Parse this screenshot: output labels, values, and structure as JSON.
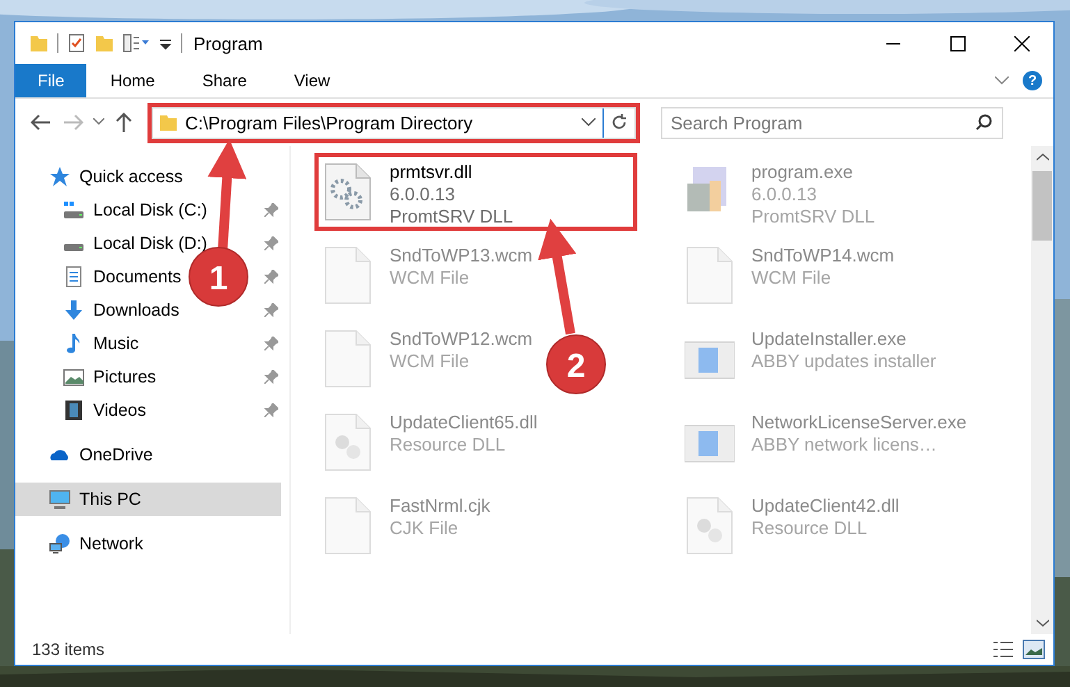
{
  "window": {
    "title": "Program"
  },
  "ribbon": {
    "tabs": [
      {
        "label": "File",
        "kind": "file"
      },
      {
        "label": "Home",
        "kind": "tab"
      },
      {
        "label": "Share",
        "kind": "tab"
      },
      {
        "label": "View",
        "kind": "tab"
      }
    ],
    "help": "?"
  },
  "address_bar": {
    "path": "C:\\Program Files\\Program Directory",
    "highlighted": true
  },
  "search": {
    "placeholder": "Search Program"
  },
  "navigation": [
    {
      "label": "Quick access",
      "kind": "star",
      "selected": false,
      "children": [
        {
          "label": "Local Disk (C:)",
          "kind": "system-drive",
          "pinned": true,
          "selected": false
        },
        {
          "label": "Local Disk (D:)",
          "kind": "drive",
          "pinned": true,
          "selected": false
        },
        {
          "label": "Documents",
          "kind": "documents",
          "pinned": true,
          "selected": false
        },
        {
          "label": "Downloads",
          "kind": "downloads",
          "pinned": true,
          "selected": false
        },
        {
          "label": "Music",
          "kind": "music",
          "pinned": true,
          "selected": false
        },
        {
          "label": "Pictures",
          "kind": "pictures",
          "pinned": true,
          "selected": false
        },
        {
          "label": "Videos",
          "kind": "videos",
          "pinned": true,
          "selected": false
        }
      ]
    },
    {
      "label": "OneDrive",
      "kind": "cloud",
      "selected": false
    },
    {
      "label": "This PC",
      "kind": "computer",
      "selected": true
    },
    {
      "label": "Network",
      "kind": "network",
      "selected": false
    }
  ],
  "files": [
    {
      "name": "prmtsvr.dll",
      "details": [
        "6.0.0.13",
        "PromtSRV DLL"
      ],
      "kind": "gear-doc",
      "highlighted": true,
      "faded": false
    },
    {
      "name": "program.exe",
      "details": [
        "6.0.0.13",
        "PromtSRV DLL"
      ],
      "kind": "installer",
      "highlighted": false,
      "faded": true
    },
    {
      "name": "SndToWP13.wcm",
      "details": [
        "WCM File"
      ],
      "kind": "blank",
      "highlighted": false,
      "faded": true
    },
    {
      "name": "SndToWP14.wcm",
      "details": [
        "WCM File"
      ],
      "kind": "blank",
      "highlighted": false,
      "faded": true
    },
    {
      "name": "SndToWP12.wcm",
      "details": [
        "WCM File"
      ],
      "kind": "blank",
      "highlighted": false,
      "faded": true
    },
    {
      "name": "UpdateInstaller.exe",
      "details": [
        "ABBY updates installer"
      ],
      "kind": "app",
      "highlighted": false,
      "faded": true
    },
    {
      "name": "UpdateClient65.dll",
      "details": [
        "Resource DLL"
      ],
      "kind": "dll",
      "highlighted": false,
      "faded": true
    },
    {
      "name": "NetworkLicenseServer.exe",
      "details": [
        "ABBY network licens…"
      ],
      "kind": "app",
      "highlighted": false,
      "faded": true
    },
    {
      "name": "FastNrml.cjk",
      "details": [
        "CJK File"
      ],
      "kind": "blank",
      "highlighted": false,
      "faded": true
    },
    {
      "name": "UpdateClient42.dll",
      "details": [
        "Resource DLL"
      ],
      "kind": "dll",
      "highlighted": false,
      "faded": true
    }
  ],
  "status_bar": {
    "item_count": "133 items"
  },
  "callouts": [
    {
      "number": "1"
    },
    {
      "number": "2"
    }
  ]
}
